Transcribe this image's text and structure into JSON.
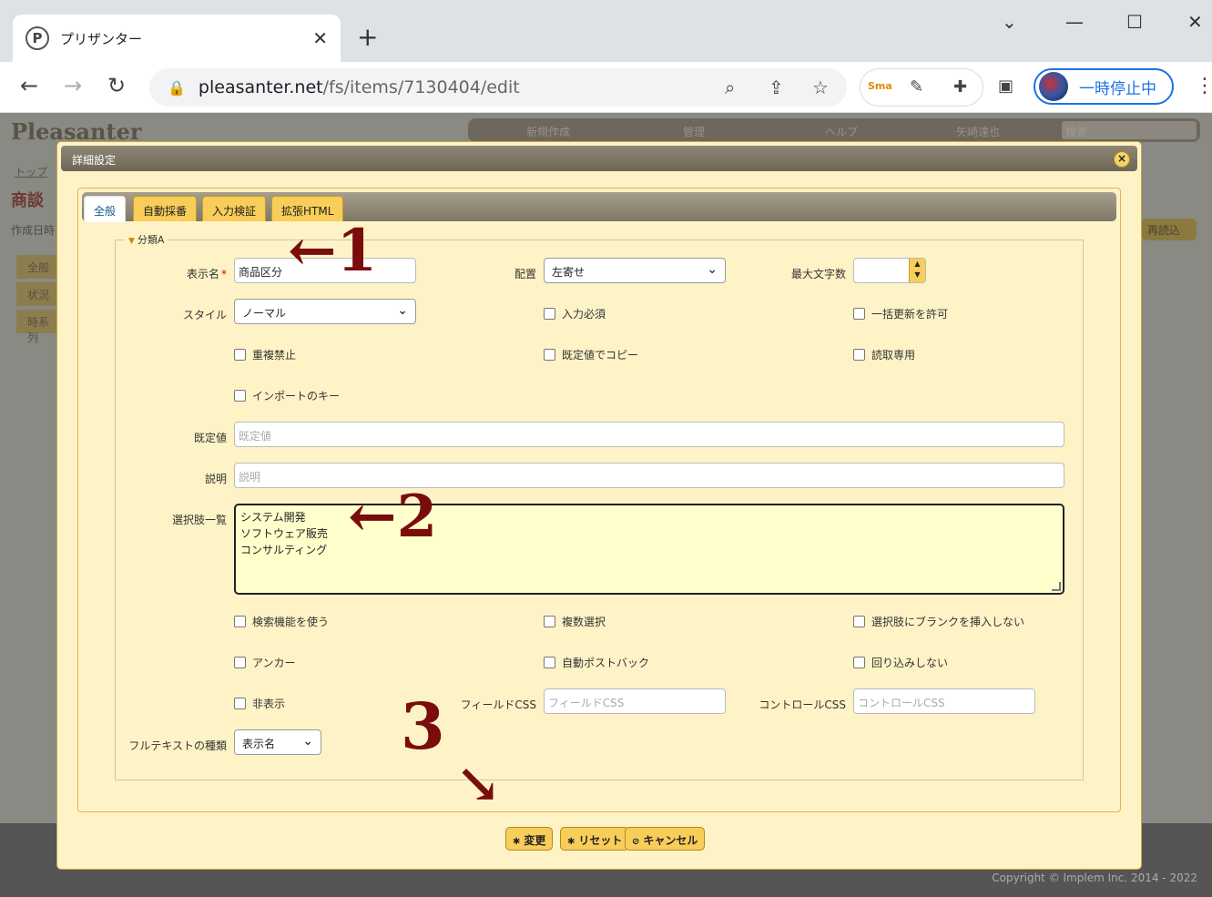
{
  "browser": {
    "tab_title": "プリザンター",
    "favicon_letter": "P",
    "url_host": "pleasanter.net",
    "url_path": "/fs/items/7130404/edit",
    "profile_label": "一時停止中"
  },
  "page": {
    "logo": "Pleasanter",
    "nav": [
      "新規作成",
      "管理",
      "ヘルプ",
      "矢崎達也"
    ],
    "search_placeholder": "検索",
    "breadcrumb": "トップ",
    "title": "商談",
    "date_label": "作成日時",
    "reload": "再読込",
    "side_tabs": [
      "全般",
      "状況",
      "時系列"
    ],
    "copyright": "Copyright © Implem Inc. 2014 - 2022"
  },
  "dialog": {
    "title": "詳細設定",
    "close": "×",
    "tabs": [
      "全般",
      "自動採番",
      "入力検証",
      "拡張HTML"
    ],
    "legend": "分類A",
    "fields": {
      "display_name_label": "表示名",
      "display_name_value": "商品区分",
      "alignment_label": "配置",
      "alignment_value": "左寄せ",
      "max_chars_label": "最大文字数",
      "style_label": "スタイル",
      "style_value": "ノーマル",
      "required": "入力必須",
      "bulk_update": "一括更新を許可",
      "no_duplicates": "重複禁止",
      "copy_default": "既定値でコピー",
      "read_only": "読取専用",
      "import_key": "インポートのキー",
      "default_label": "既定値",
      "default_placeholder": "既定値",
      "description_label": "説明",
      "description_placeholder": "説明",
      "choices_label": "選択肢一覧",
      "choices": [
        "システム開発",
        "ソフトウェア販売",
        "コンサルティング"
      ],
      "use_search": "検索機能を使う",
      "multi_select": "複数選択",
      "no_blank": "選択肢にブランクを挿入しない",
      "anchor": "アンカー",
      "auto_postback": "自動ポストバック",
      "no_wrap": "回り込みしない",
      "hidden": "非表示",
      "field_css_label": "フィールドCSS",
      "field_css_placeholder": "フィールドCSS",
      "control_css_label": "コントロールCSS",
      "control_css_placeholder": "コントロールCSS",
      "fulltext_label": "フルテキストの種類",
      "fulltext_value": "表示名"
    },
    "buttons": {
      "change": "変更",
      "reset": "リセット",
      "cancel": "キャンセル"
    }
  },
  "annotations": [
    "←1",
    "←2",
    "3",
    "↘"
  ]
}
